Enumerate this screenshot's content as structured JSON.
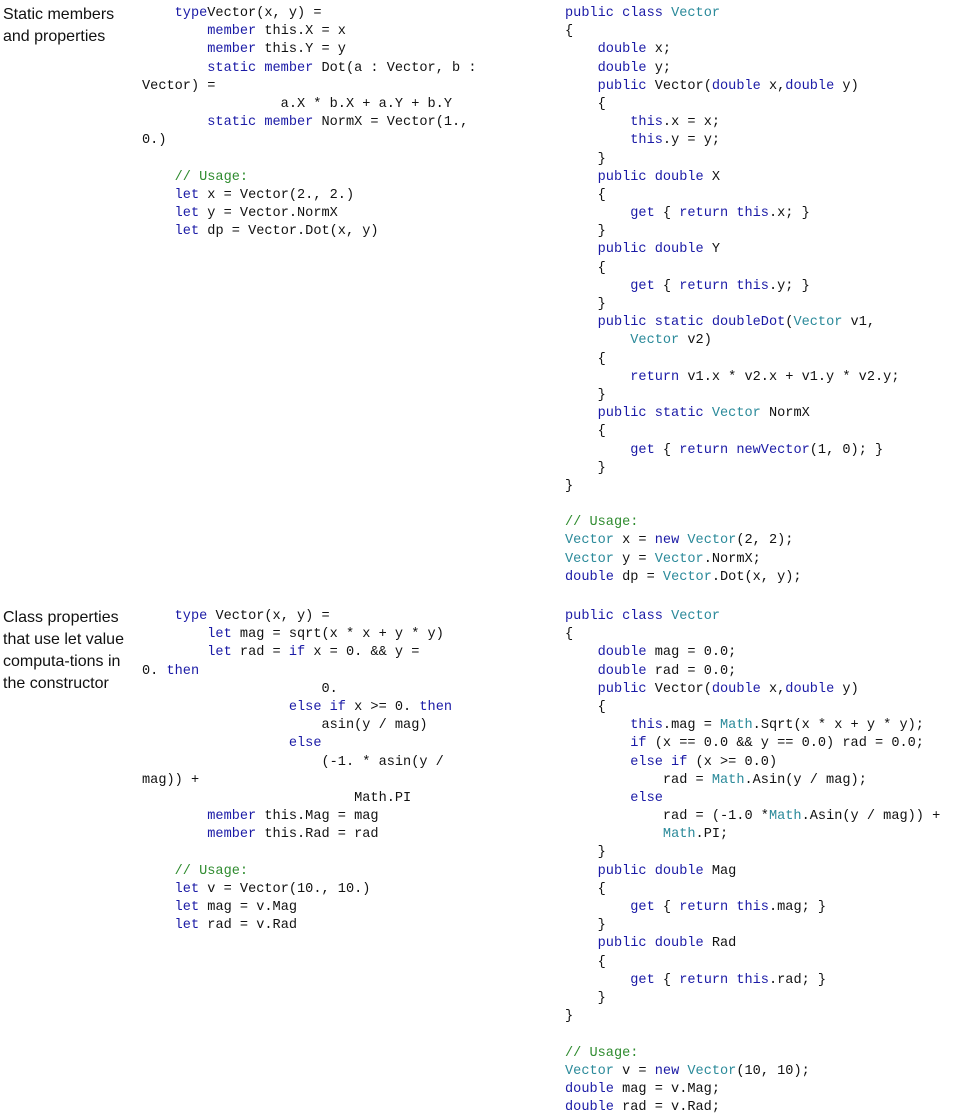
{
  "sections": [
    {
      "label": "Static members and properties",
      "fsharp": [
        [
          [
            "kw",
            "    type"
          ],
          [
            "",
            "Vector(x, y) ="
          ]
        ],
        [
          [
            "",
            "        "
          ],
          [
            "kw",
            "member"
          ],
          [
            "",
            " this.X = x"
          ]
        ],
        [
          [
            "",
            "        "
          ],
          [
            "kw",
            "member"
          ],
          [
            "",
            " this.Y = y"
          ]
        ],
        [
          [
            "",
            "        "
          ],
          [
            "kw",
            "static member"
          ],
          [
            "",
            " Dot(a : Vector, b :"
          ]
        ],
        [
          [
            "",
            "Vector) ="
          ]
        ],
        [
          [
            "",
            "                 a.X * b.X + a.Y + b.Y"
          ]
        ],
        [
          [
            "",
            "        "
          ],
          [
            "kw",
            "static member"
          ],
          [
            "",
            " NormX = Vector(1.,"
          ]
        ],
        [
          [
            "",
            "0.)"
          ]
        ],
        [
          [
            "",
            ""
          ]
        ],
        [
          [
            "",
            "    "
          ],
          [
            "cm",
            "// Usage:"
          ]
        ],
        [
          [
            "",
            "    "
          ],
          [
            "kw",
            "let"
          ],
          [
            "",
            " x = Vector(2., 2.)"
          ]
        ],
        [
          [
            "",
            "    "
          ],
          [
            "kw",
            "let"
          ],
          [
            "",
            " y = Vector.NormX"
          ]
        ],
        [
          [
            "",
            "    "
          ],
          [
            "kw",
            "let"
          ],
          [
            "",
            " dp = Vector.Dot(x, y)"
          ]
        ]
      ],
      "csharp": [
        [
          [
            "kw",
            "public class "
          ],
          [
            "ty",
            "Vector"
          ]
        ],
        [
          [
            "",
            "{"
          ]
        ],
        [
          [
            "",
            "    "
          ],
          [
            "kw",
            "double"
          ],
          [
            "",
            " x;"
          ]
        ],
        [
          [
            "",
            "    "
          ],
          [
            "kw",
            "double"
          ],
          [
            "",
            " y;"
          ]
        ],
        [
          [
            "",
            "    "
          ],
          [
            "kw",
            "public"
          ],
          [
            "",
            " Vector("
          ],
          [
            "kw",
            "double"
          ],
          [
            "",
            " x,"
          ],
          [
            "kw",
            "double"
          ],
          [
            "",
            " y)"
          ]
        ],
        [
          [
            "",
            "    {"
          ]
        ],
        [
          [
            "",
            "        "
          ],
          [
            "kw",
            "this"
          ],
          [
            "",
            ".x = x;"
          ]
        ],
        [
          [
            "",
            "        "
          ],
          [
            "kw",
            "this"
          ],
          [
            "",
            ".y = y;"
          ]
        ],
        [
          [
            "",
            "    }"
          ]
        ],
        [
          [
            "",
            "    "
          ],
          [
            "kw",
            "public double"
          ],
          [
            "",
            " X"
          ]
        ],
        [
          [
            "",
            "    {"
          ]
        ],
        [
          [
            "",
            "        "
          ],
          [
            "kw",
            "get"
          ],
          [
            "",
            " { "
          ],
          [
            "kw",
            "return this"
          ],
          [
            "",
            ".x; }"
          ]
        ],
        [
          [
            "",
            "    }"
          ]
        ],
        [
          [
            "",
            "    "
          ],
          [
            "kw",
            "public double"
          ],
          [
            "",
            " Y"
          ]
        ],
        [
          [
            "",
            "    {"
          ]
        ],
        [
          [
            "",
            "        "
          ],
          [
            "kw",
            "get"
          ],
          [
            "",
            " { "
          ],
          [
            "kw",
            "return this"
          ],
          [
            "",
            ".y; }"
          ]
        ],
        [
          [
            "",
            "    }"
          ]
        ],
        [
          [
            "",
            "    "
          ],
          [
            "kw",
            "public static doubleDot"
          ],
          [
            "",
            "("
          ],
          [
            "ty",
            "Vector"
          ],
          [
            "",
            " v1,"
          ]
        ],
        [
          [
            "",
            "        "
          ],
          [
            "ty",
            "Vector"
          ],
          [
            "",
            " v2)"
          ]
        ],
        [
          [
            "",
            "    {"
          ]
        ],
        [
          [
            "",
            "        "
          ],
          [
            "kw",
            "return"
          ],
          [
            "",
            " v1.x * v2.x + v1.y * v2.y;"
          ]
        ],
        [
          [
            "",
            "    }"
          ]
        ],
        [
          [
            "",
            "    "
          ],
          [
            "kw",
            "public static "
          ],
          [
            "ty",
            "Vector"
          ],
          [
            "",
            " NormX"
          ]
        ],
        [
          [
            "",
            "    {"
          ]
        ],
        [
          [
            "",
            "        "
          ],
          [
            "kw",
            "get"
          ],
          [
            "",
            " { "
          ],
          [
            "kw",
            "return newVector"
          ],
          [
            "",
            "(1, 0); }"
          ]
        ],
        [
          [
            "",
            "    }"
          ]
        ],
        [
          [
            "",
            "}"
          ]
        ],
        [
          [
            "",
            ""
          ]
        ],
        [
          [
            "cm",
            "// Usage:"
          ]
        ],
        [
          [
            "ty",
            "Vector"
          ],
          [
            "",
            " x = "
          ],
          [
            "kw",
            "new "
          ],
          [
            "ty",
            "Vector"
          ],
          [
            "",
            "(2, 2);"
          ]
        ],
        [
          [
            "ty",
            "Vector"
          ],
          [
            "",
            " y = "
          ],
          [
            "ty",
            "Vector"
          ],
          [
            "",
            ".NormX;"
          ]
        ],
        [
          [
            "kw",
            "double"
          ],
          [
            "",
            " dp = "
          ],
          [
            "ty",
            "Vector"
          ],
          [
            "",
            ".Dot(x, y);"
          ]
        ]
      ]
    },
    {
      "label": "Class properties that use let value computa-tions in the constructor",
      "fsharp": [
        [
          [
            "",
            "    "
          ],
          [
            "kw",
            "type"
          ],
          [
            "",
            " Vector(x, y) ="
          ]
        ],
        [
          [
            "",
            "        "
          ],
          [
            "kw",
            "let"
          ],
          [
            "",
            " mag = sqrt(x * x + y * y)"
          ]
        ],
        [
          [
            "",
            "        "
          ],
          [
            "kw",
            "let"
          ],
          [
            "",
            " rad = "
          ],
          [
            "kw",
            "if"
          ],
          [
            "",
            " x = 0. && y ="
          ]
        ],
        [
          [
            "",
            "0. "
          ],
          [
            "kw",
            "then"
          ]
        ],
        [
          [
            "",
            "                      0."
          ]
        ],
        [
          [
            "",
            "                  "
          ],
          [
            "kw",
            "else if"
          ],
          [
            "",
            " x >= 0. "
          ],
          [
            "kw",
            "then"
          ]
        ],
        [
          [
            "",
            "                      asin(y / mag)"
          ]
        ],
        [
          [
            "",
            "                  "
          ],
          [
            "kw",
            "else"
          ]
        ],
        [
          [
            "",
            "                      (-1. * asin(y /"
          ]
        ],
        [
          [
            "",
            "mag)) +"
          ]
        ],
        [
          [
            "",
            "                          Math.PI"
          ]
        ],
        [
          [
            "",
            "        "
          ],
          [
            "kw",
            "member"
          ],
          [
            "",
            " this.Mag = mag"
          ]
        ],
        [
          [
            "",
            "        "
          ],
          [
            "kw",
            "member"
          ],
          [
            "",
            " this.Rad = rad"
          ]
        ],
        [
          [
            "",
            ""
          ]
        ],
        [
          [
            "",
            "    "
          ],
          [
            "cm",
            "// Usage:"
          ]
        ],
        [
          [
            "",
            "    "
          ],
          [
            "kw",
            "let"
          ],
          [
            "",
            " v = Vector(10., 10.)"
          ]
        ],
        [
          [
            "",
            "    "
          ],
          [
            "kw",
            "let"
          ],
          [
            "",
            " mag = v.Mag"
          ]
        ],
        [
          [
            "",
            "    "
          ],
          [
            "kw",
            "let"
          ],
          [
            "",
            " rad = v.Rad"
          ]
        ]
      ],
      "csharp": [
        [
          [
            "kw",
            "public class "
          ],
          [
            "ty",
            "Vector"
          ]
        ],
        [
          [
            "",
            "{"
          ]
        ],
        [
          [
            "",
            "    "
          ],
          [
            "kw",
            "double"
          ],
          [
            "",
            " mag = 0.0;"
          ]
        ],
        [
          [
            "",
            "    "
          ],
          [
            "kw",
            "double"
          ],
          [
            "",
            " rad = 0.0;"
          ]
        ],
        [
          [
            "",
            "    "
          ],
          [
            "kw",
            "public"
          ],
          [
            "",
            " Vector("
          ],
          [
            "kw",
            "double"
          ],
          [
            "",
            " x,"
          ],
          [
            "kw",
            "double"
          ],
          [
            "",
            " y)"
          ]
        ],
        [
          [
            "",
            "    {"
          ]
        ],
        [
          [
            "",
            "        "
          ],
          [
            "kw",
            "this"
          ],
          [
            "",
            ".mag = "
          ],
          [
            "ty",
            "Math"
          ],
          [
            "",
            ".Sqrt(x * x + y * y);"
          ]
        ],
        [
          [
            "",
            "        "
          ],
          [
            "kw",
            "if"
          ],
          [
            "",
            " (x == 0.0 && y == 0.0) rad = 0.0;"
          ]
        ],
        [
          [
            "",
            "        "
          ],
          [
            "kw",
            "else if"
          ],
          [
            "",
            " (x >= 0.0)"
          ]
        ],
        [
          [
            "",
            "            rad = "
          ],
          [
            "ty",
            "Math"
          ],
          [
            "",
            ".Asin(y / mag);"
          ]
        ],
        [
          [
            "",
            "        "
          ],
          [
            "kw",
            "else"
          ]
        ],
        [
          [
            "",
            "            rad = (-1.0 *"
          ],
          [
            "ty",
            "Math"
          ],
          [
            "",
            ".Asin(y / mag)) +"
          ]
        ],
        [
          [
            "",
            "            "
          ],
          [
            "ty",
            "Math"
          ],
          [
            "",
            ".PI;"
          ]
        ],
        [
          [
            "",
            "    }"
          ]
        ],
        [
          [
            "",
            "    "
          ],
          [
            "kw",
            "public double"
          ],
          [
            "",
            " Mag"
          ]
        ],
        [
          [
            "",
            "    {"
          ]
        ],
        [
          [
            "",
            "        "
          ],
          [
            "kw",
            "get"
          ],
          [
            "",
            " { "
          ],
          [
            "kw",
            "return this"
          ],
          [
            "",
            ".mag; }"
          ]
        ],
        [
          [
            "",
            "    }"
          ]
        ],
        [
          [
            "",
            "    "
          ],
          [
            "kw",
            "public double"
          ],
          [
            "",
            " Rad"
          ]
        ],
        [
          [
            "",
            "    {"
          ]
        ],
        [
          [
            "",
            "        "
          ],
          [
            "kw",
            "get"
          ],
          [
            "",
            " { "
          ],
          [
            "kw",
            "return this"
          ],
          [
            "",
            ".rad; }"
          ]
        ],
        [
          [
            "",
            "    }"
          ]
        ],
        [
          [
            "",
            "}"
          ]
        ],
        [
          [
            "",
            ""
          ]
        ],
        [
          [
            "cm",
            "// Usage:"
          ]
        ],
        [
          [
            "ty",
            "Vector"
          ],
          [
            "",
            " v = "
          ],
          [
            "kw",
            "new "
          ],
          [
            "ty",
            "Vector"
          ],
          [
            "",
            "(10, 10);"
          ]
        ],
        [
          [
            "kw",
            "double"
          ],
          [
            "",
            " mag = v.Mag;"
          ]
        ],
        [
          [
            "kw",
            "double"
          ],
          [
            "",
            " rad = v.Rad;"
          ]
        ]
      ]
    }
  ]
}
